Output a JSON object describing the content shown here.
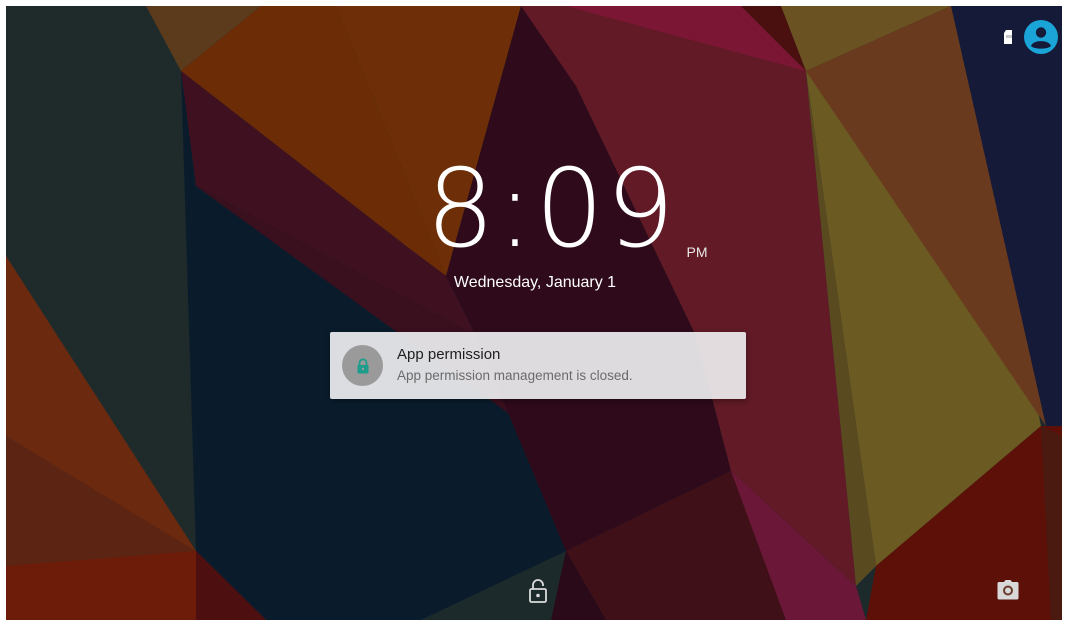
{
  "lockscreen": {
    "time": "8:09",
    "ampm": "PM",
    "date": "Wednesday, January 1"
  },
  "notification": {
    "title": "App permission",
    "text": "App permission management is closed.",
    "icon": "lock-icon",
    "icon_color": "#1e9c8c"
  },
  "status_bar": {
    "icons": [
      "sim-icon",
      "user-account-icon"
    ],
    "accent": "#1ba4d8"
  },
  "bottom_actions": {
    "left": "unlock-icon",
    "right": "camera-icon"
  }
}
